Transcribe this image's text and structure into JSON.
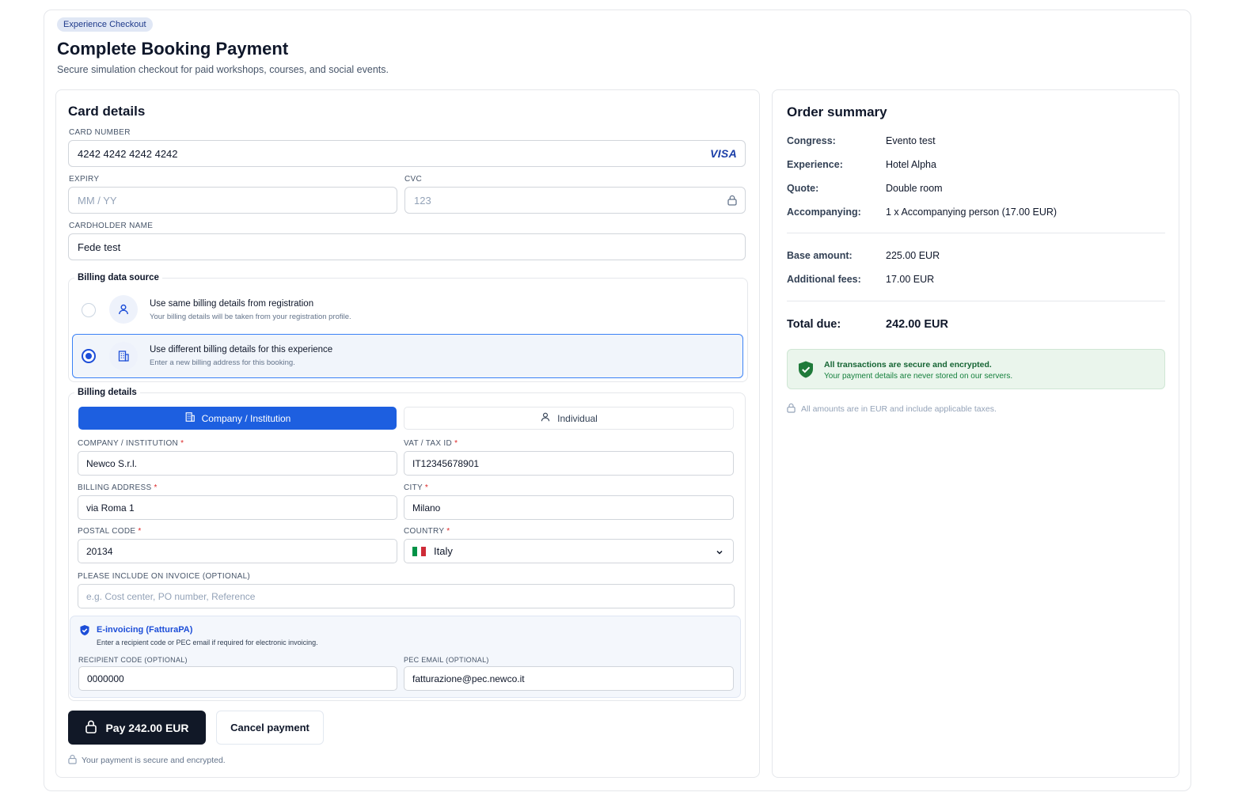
{
  "header": {
    "badge": "Experience Checkout",
    "title": "Complete Booking Payment",
    "subtitle": "Secure simulation checkout for paid workshops, courses, and social events."
  },
  "card": {
    "heading": "Card details",
    "number_label": "CARD NUMBER",
    "number_value": "4242 4242 4242 4242",
    "brand": "VISA",
    "expiry_label": "EXPIRY",
    "expiry_placeholder": "MM / YY",
    "cvc_label": "CVC",
    "cvc_placeholder": "123",
    "holder_label": "CARDHOLDER NAME",
    "holder_value": "Fede test"
  },
  "billing_source": {
    "legend": "Billing data source",
    "options": [
      {
        "title": "Use same billing details from registration",
        "sub": "Your billing details will be taken from your registration profile.",
        "selected": false,
        "icon": "user-icon"
      },
      {
        "title": "Use different billing details for this experience",
        "sub": "Enter a new billing address for this booking.",
        "selected": true,
        "icon": "building-icon"
      }
    ]
  },
  "billing": {
    "legend": "Billing details",
    "tabs": [
      {
        "label": "Company / Institution",
        "active": true,
        "icon": "building-icon"
      },
      {
        "label": "Individual",
        "active": false,
        "icon": "user-icon"
      }
    ],
    "company_label": "COMPANY / INSTITUTION",
    "company_value": "Newco S.r.l.",
    "vat_label": "VAT / TAX ID",
    "vat_value": "IT12345678901",
    "address_label": "BILLING ADDRESS",
    "address_value": "via Roma 1",
    "city_label": "CITY",
    "city_value": "Milano",
    "postal_label": "POSTAL CODE",
    "postal_value": "20134",
    "country_label": "COUNTRY",
    "country_value": "Italy",
    "invoice_label": "PLEASE INCLUDE ON INVOICE (OPTIONAL)",
    "invoice_placeholder": "e.g. Cost center, PO number, Reference",
    "required_mark": "*"
  },
  "einvoicing": {
    "title": "E-invoicing (FatturaPA)",
    "sub": "Enter a recipient code or PEC email if required for electronic invoicing.",
    "recipient_label": "RECIPIENT CODE (OPTIONAL)",
    "recipient_value": "0000000",
    "pec_label": "PEC EMAIL (OPTIONAL)",
    "pec_value": "fatturazione@pec.newco.it"
  },
  "actions": {
    "pay_label": "Pay 242.00 EUR",
    "cancel_label": "Cancel payment",
    "secure_note": "Your payment is secure and encrypted."
  },
  "summary": {
    "heading": "Order summary",
    "rows": [
      {
        "k": "Congress:",
        "v": "Evento test"
      },
      {
        "k": "Experience:",
        "v": "Hotel Alpha"
      },
      {
        "k": "Quote:",
        "v": "Double room"
      },
      {
        "k": "Accompanying:",
        "v": "1 x Accompanying person (17.00 EUR)"
      }
    ],
    "amounts": [
      {
        "k": "Base amount:",
        "v": "225.00 EUR"
      },
      {
        "k": "Additional fees:",
        "v": "17.00 EUR"
      }
    ],
    "total_label": "Total due:",
    "total_value": "242.00 EUR",
    "secure_title": "All transactions are secure and encrypted.",
    "secure_sub": "Your payment details are never stored on our servers.",
    "amounts_note": "All amounts are in EUR and include applicable taxes."
  },
  "colors": {
    "primary": "#1d5fe0",
    "dark_button": "#111827",
    "success": "#166534",
    "required": "#dc2626",
    "flag_italy": [
      "#009246",
      "#ffffff",
      "#ce2b37"
    ]
  }
}
